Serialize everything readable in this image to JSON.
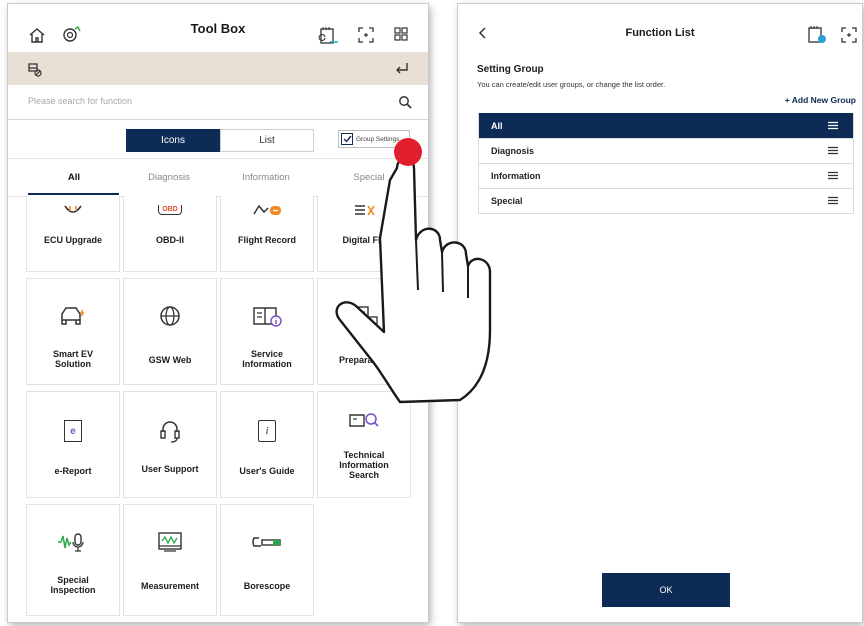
{
  "toolbox": {
    "title": "Tool Box",
    "search_placeholder": "Please search for function",
    "view_icons": "Icons",
    "view_list": "List",
    "group_settings": "Group Settings",
    "categories": [
      "All",
      "Diagnosis",
      "Information",
      "Special"
    ],
    "tiles": [
      {
        "label": "ECU Upgrade",
        "icon": "ecu-upgrade-icon"
      },
      {
        "label": "OBD-II",
        "icon": "obd-icon",
        "icon_text": "OBD"
      },
      {
        "label": "Flight Record",
        "icon": "flight-record-icon"
      },
      {
        "label": "Digital Fle",
        "icon": "digital-field-icon"
      },
      {
        "label": "Smart EV Solution",
        "icon": "ev-car-icon"
      },
      {
        "label": "GSW Web",
        "icon": "globe-icon"
      },
      {
        "label": "Service Information",
        "icon": "book-info-icon"
      },
      {
        "label": "Preparation",
        "icon": "preparation-icon"
      },
      {
        "label": "e-Report",
        "icon": "e-report-icon",
        "icon_text": "e"
      },
      {
        "label": "User Support",
        "icon": "headset-icon"
      },
      {
        "label": "User's Guide",
        "icon": "guide-icon",
        "icon_text": "i"
      },
      {
        "label": "Technical Information Search",
        "icon": "tech-search-icon"
      },
      {
        "label": "Special Inspection",
        "icon": "sound-inspection-icon"
      },
      {
        "label": "Measurement",
        "icon": "measurement-icon"
      },
      {
        "label": "Borescope",
        "icon": "borescope-icon"
      }
    ]
  },
  "function_list": {
    "title": "Function List",
    "setting_group": "Setting Group",
    "description": "You can create/edit user groups, or change the list order.",
    "add_new_group": "+ Add New Group",
    "groups": [
      "All",
      "Diagnosis",
      "Information",
      "Special"
    ],
    "ok_label": "OK"
  },
  "colors": {
    "primary": "#0d2b55",
    "vehicle_bar": "#e8dfd5",
    "touch_dot": "#e01e2e",
    "ev_accent": "#f08a24",
    "purple_accent": "#7a4fc6",
    "green_accent": "#2ea84a"
  }
}
